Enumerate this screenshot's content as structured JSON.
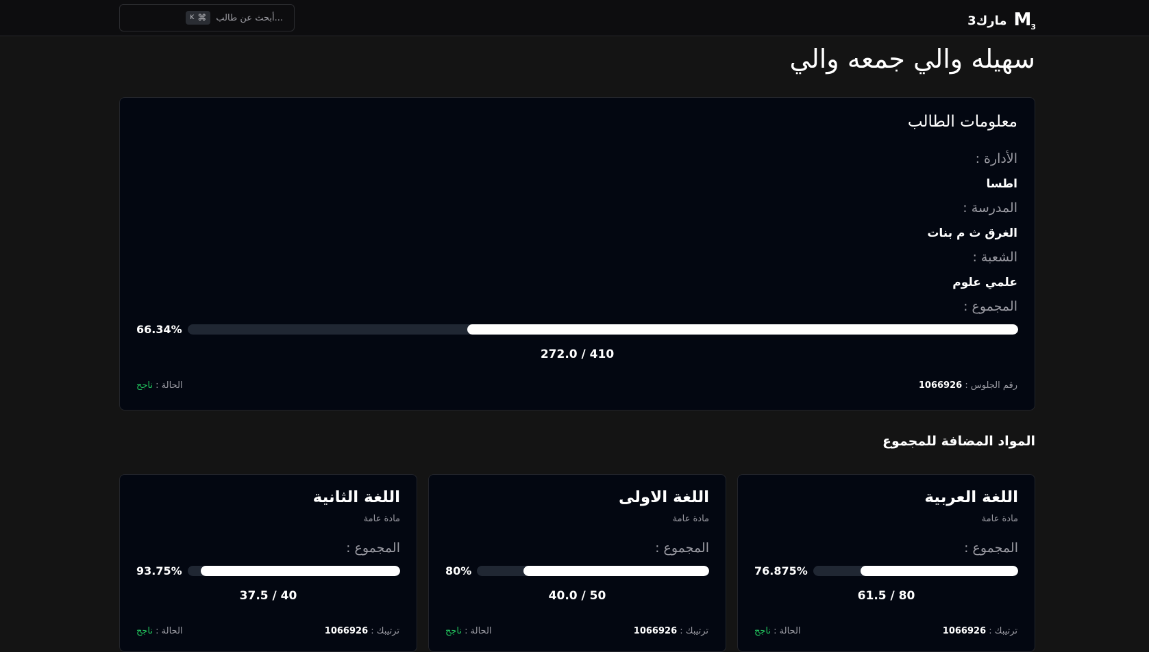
{
  "header": {
    "logo_mark": "M",
    "logo_mark_sub": "3",
    "logo_text": "مارك3",
    "search_placeholder": "أبحث عن طالب...",
    "shortcut_key": "K",
    "shortcut_cmd": "⌘"
  },
  "student": {
    "name": "سهيله والي جمعه والي",
    "card_title": "معلومات الطالب",
    "administration_label": "الأدارة :",
    "administration_value": "اطسا",
    "school_label": "المدرسة :",
    "school_value": "الغرق ث م بنات",
    "division_label": "الشعبة :",
    "division_value": "علمي علوم",
    "total_label": "المجموع :",
    "total_percent": "66.34%",
    "total_fraction": 0.6634,
    "total_score": "272.0 / 410",
    "seat_label": "رقم الجلوس :",
    "seat_number": "1066926",
    "status_label": "الحالة :",
    "status_value": "ناجح"
  },
  "subjects_section": {
    "title": "المواد المضافة للمجموع",
    "items": [
      {
        "name": "اللغة العربية",
        "type": "مادة عامة",
        "total_label": "المجموع :",
        "percent": "76.875%",
        "fraction": 0.76875,
        "score": "61.5 / 80",
        "rank_label": "ترتيبك :",
        "rank_value": "1066926",
        "status_label": "الحالة :",
        "status_value": "ناجح"
      },
      {
        "name": "اللغة الاولى",
        "type": "مادة عامة",
        "total_label": "المجموع :",
        "percent": "80%",
        "fraction": 0.8,
        "score": "40.0 / 50",
        "rank_label": "ترتيبك :",
        "rank_value": "1066926",
        "status_label": "الحالة :",
        "status_value": "ناجح"
      },
      {
        "name": "اللغة الثانية",
        "type": "مادة عامة",
        "total_label": "المجموع :",
        "percent": "93.75%",
        "fraction": 0.9375,
        "score": "37.5 / 40",
        "rank_label": "ترتيبك :",
        "rank_value": "1066926",
        "status_label": "الحالة :",
        "status_value": "ناجح"
      }
    ]
  },
  "colors": {
    "background": "#141414",
    "card": "#030711",
    "success": "#22c55e",
    "track": "#202733"
  }
}
